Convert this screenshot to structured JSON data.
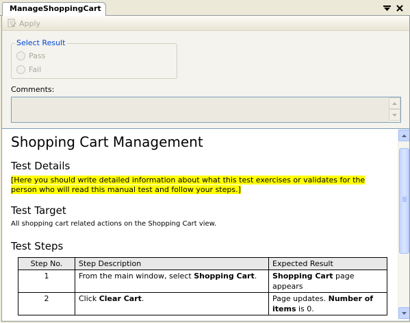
{
  "tab": {
    "title": "ManageShoppingCart"
  },
  "toolbar": {
    "apply_label": "Apply"
  },
  "select_result": {
    "legend": "Select Result",
    "options": [
      "Pass",
      "Fail"
    ]
  },
  "comments": {
    "label": "Comments:",
    "value": ""
  },
  "document": {
    "title": "Shopping Cart Management",
    "test_details_heading": "Test Details",
    "test_details_text": "[Here you should write detailed information about what this test exercises or validates for the person who will read this manual test and follow your steps.]",
    "test_target_heading": "Test Target",
    "test_target_text": "All shopping cart related actions on the Shopping Cart view.",
    "test_steps_heading": "Test Steps",
    "table": {
      "headers": [
        "Step No.",
        "Step Description",
        "Expected Result"
      ],
      "rows": [
        {
          "no": "1",
          "desc_prefix": "From the main window, select ",
          "desc_bold": "Shopping Cart",
          "desc_suffix": ".",
          "res_bold": "Shopping Cart",
          "res_suffix": " page appears",
          "res_bold2": "",
          "res_suffix2": ""
        },
        {
          "no": "2",
          "desc_prefix": "Click ",
          "desc_bold": "Clear Cart",
          "desc_suffix": ".",
          "res_prefix": "Page updates. ",
          "res_bold": "Number of items",
          "res_suffix": " is 0."
        }
      ]
    }
  },
  "colors": {
    "legend": "#0046d5",
    "highlight": "#ffff00",
    "chrome": "#ece9d8"
  }
}
